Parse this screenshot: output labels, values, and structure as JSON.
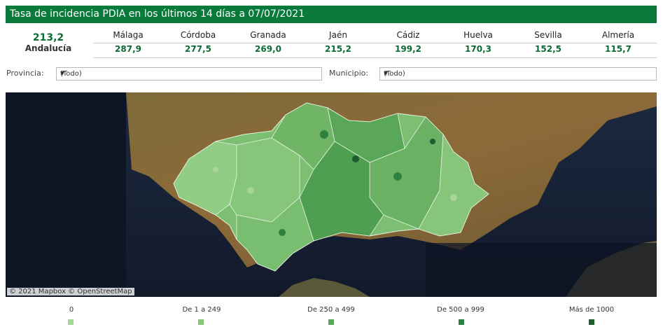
{
  "header": {
    "title": "Tasa de incidencia PDIA en los últimos 14 días a 07/07/2021"
  },
  "summary": {
    "value": "213,2",
    "label": "Andalucía"
  },
  "provinces": [
    {
      "name": "Málaga",
      "value": "287,9"
    },
    {
      "name": "Córdoba",
      "value": "277,5"
    },
    {
      "name": "Granada",
      "value": "269,0"
    },
    {
      "name": "Jaén",
      "value": "215,2"
    },
    {
      "name": "Cádiz",
      "value": "199,2"
    },
    {
      "name": "Huelva",
      "value": "170,3"
    },
    {
      "name": "Sevilla",
      "value": "152,5"
    },
    {
      "name": "Almería",
      "value": "115,7"
    }
  ],
  "filters": {
    "provincia_label": "Provincia:",
    "provincia_value": "(Todo)",
    "municipio_label": "Municipio:",
    "municipio_value": "(Todo)"
  },
  "map": {
    "attribution": "© 2021 Mapbox  © OpenStreetMap"
  },
  "legend": [
    {
      "label": "0",
      "color": "#a8d59a"
    },
    {
      "label": "De 1 a 249",
      "color": "#86c57a"
    },
    {
      "label": "De 250 a 499",
      "color": "#5aa75a"
    },
    {
      "label": "De 500 a 999",
      "color": "#2e8040"
    },
    {
      "label": "Más de 1000",
      "color": "#1b5e30"
    }
  ]
}
